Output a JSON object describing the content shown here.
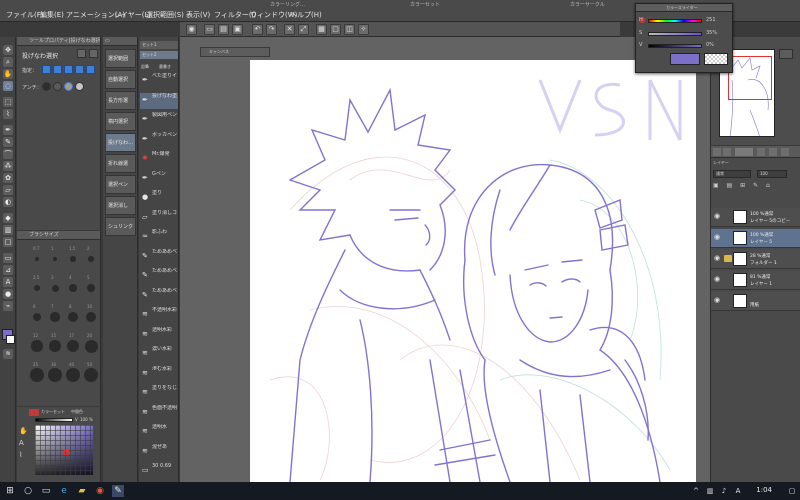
{
  "menu": {
    "items": [
      "ファイル(F)",
      "編集(E)",
      "アニメーション(A)",
      "レイヤー(L)",
      "選択範囲(S)",
      "表示(V)",
      "フィルター(I)",
      "ウィンドウ(W)",
      "ヘルプ(H)"
    ]
  },
  "tool_property": {
    "title": "ツールプロパティ[投げなわ選択]",
    "tool_name": "投げなわ選択",
    "mode_label": "指定：",
    "antialias_label": "アンチ："
  },
  "brush_size": {
    "title": "ブラシサイズ",
    "numbers": [
      "0.7",
      "1",
      "1.5",
      "2",
      "2.5",
      "3",
      "4",
      "5",
      "6",
      "7",
      "8",
      "10",
      "12",
      "15",
      "17",
      "20",
      "25",
      "30",
      "40",
      "50"
    ]
  },
  "color_panel": {
    "value_label": "V",
    "value": "100 %",
    "tab1": "カラーセット",
    "tab2": "中間色"
  },
  "subtools": [
    {
      "label": "選択範囲"
    },
    {
      "label": "自動選択"
    },
    {
      "label": "長方形選"
    },
    {
      "label": "楕円選択"
    },
    {
      "label": "投げなわ…"
    },
    {
      "label": "折れ線選"
    },
    {
      "label": "選択ペン"
    },
    {
      "label": "選択消し"
    },
    {
      "label": "シュリンク"
    }
  ],
  "brush_list": {
    "tab1": "セット1",
    "tab2": "セット2",
    "tab3": "鉛筆",
    "tab4": "墨書き",
    "items": [
      "べた塗りイン",
      "投げなわ塗り",
      "製図用ペン",
      "ボッカペン",
      "Mr.爆発",
      "Gペン",
      "塗り",
      "塗り消しゴ",
      "影ふわ",
      "ためあめべ",
      "ためあめべ",
      "ためあめべ",
      "不透明水彩",
      "透明水彩",
      "濃い水彩",
      "滲む水彩",
      "塗りをなじ",
      "色面不透明",
      "透明水",
      "混ぜあ",
      "30 0.69"
    ]
  },
  "canvas": {
    "tab_label": "キャンバス"
  },
  "color_slider": {
    "title": "カラースライダー",
    "rows": [
      {
        "label": "H",
        "value": "251"
      },
      {
        "label": "S",
        "value": "35%"
      },
      {
        "label": "V",
        "value": "0%"
      }
    ],
    "main_color": "#7b6fc8"
  },
  "title_bits": [
    "カラーリング…",
    "カラーセット",
    "カラーサークル"
  ],
  "layers": {
    "tab1": "レイヤー",
    "blend_mode": "通常",
    "opacity": "100",
    "rows": [
      {
        "line1": "100 %通常",
        "line2": "レイヤー 5のコピー",
        "selected": false,
        "folder": false
      },
      {
        "line1": "100 %通常",
        "line2": "レイヤー 5",
        "selected": true,
        "folder": false
      },
      {
        "line1": "28 %通常",
        "line2": "フォルダー 1",
        "selected": false,
        "folder": true
      },
      {
        "line1": "81 %通常",
        "line2": "レイヤー 1",
        "selected": false,
        "folder": false
      },
      {
        "line1": "",
        "line2": "用紙",
        "selected": false,
        "folder": false
      }
    ]
  },
  "taskbar": {
    "clock": "1:04"
  }
}
